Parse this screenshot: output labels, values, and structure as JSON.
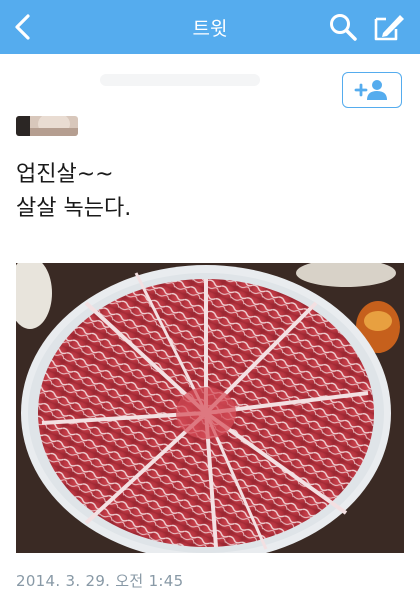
{
  "navbar": {
    "title": "트윗",
    "back_icon": "chevron-left-icon",
    "search_icon": "search-icon",
    "compose_icon": "compose-icon",
    "background_color": "#55acee"
  },
  "profile": {
    "avatar_icon": "avatar",
    "follow_button_icon": "add-user-icon"
  },
  "tweet": {
    "line1": "업진살~~",
    "line2": "살살 녹는다.",
    "photo": "marbled-beef-platter-photo",
    "timestamp": "2014. 3. 29. 오전 1:45"
  }
}
